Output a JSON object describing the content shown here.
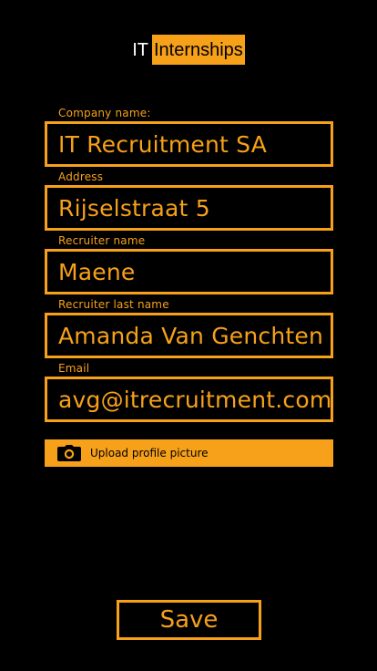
{
  "app": {
    "logo_prefix": "IT",
    "logo_highlight": "Internships"
  },
  "form": {
    "fields": [
      {
        "label": "Company name:",
        "value": "IT Recruitment SA"
      },
      {
        "label": "Address",
        "value": "Rijselstraat 5"
      },
      {
        "label": "Recruiter name",
        "value": "Maene"
      },
      {
        "label": "Recruiter last name",
        "value": "Amanda Van Genchten"
      },
      {
        "label": "Email",
        "value": "avg@itrecruitment.com"
      }
    ],
    "upload_label": "Upload profile picture",
    "save_label": "Save"
  },
  "colors": {
    "accent": "#F7A11A",
    "background": "#000000",
    "logo_text": "#FFFFFF"
  },
  "icons": {
    "upload": "camera-icon"
  }
}
